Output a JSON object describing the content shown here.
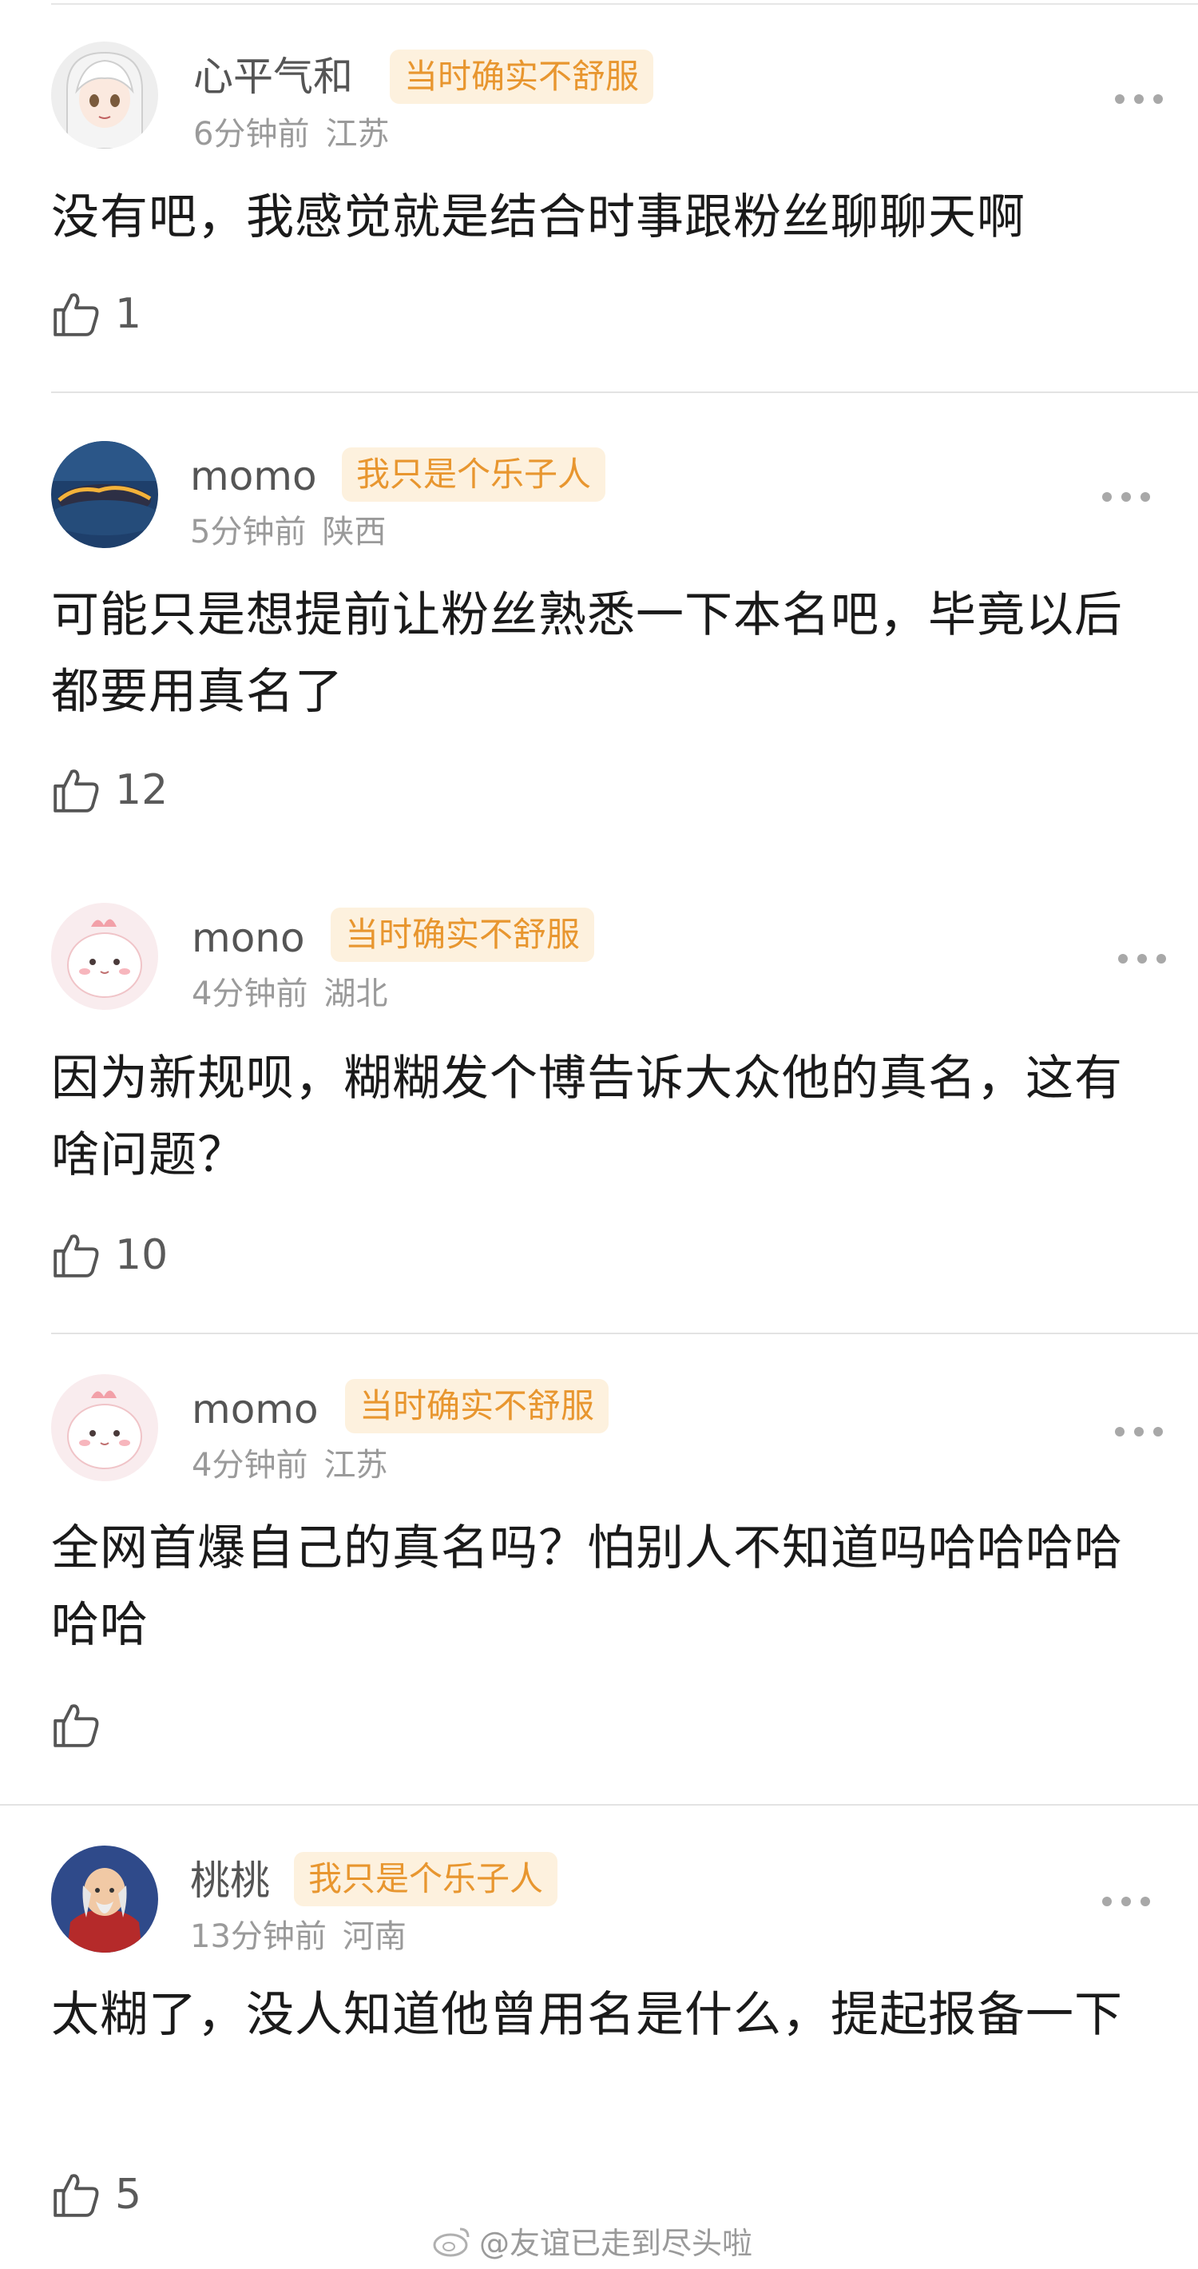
{
  "comments": [
    {
      "username": "心平气和",
      "badge": "当时确实不舒服",
      "time": "6分钟前",
      "location": "江苏",
      "text": "没有吧，我感觉就是结合时事跟粉丝聊聊天啊",
      "likes": "1",
      "avatar_icon": "anime-girl-avatar"
    },
    {
      "username": "momo",
      "badge": "我只是个乐子人",
      "time": "5分钟前",
      "location": "陕西",
      "text": "可能只是想提前让粉丝熟悉一下本名吧，毕竟以后都要用真名了",
      "likes": "12",
      "avatar_icon": "sky-cloud-avatar"
    },
    {
      "username": "mono",
      "badge": "当时确实不舒服",
      "time": "4分钟前",
      "location": "湖北",
      "text": "因为新规呗，糊糊发个博告诉大众他的真名，这有啥问题？",
      "likes": "10",
      "avatar_icon": "pink-cartoon-avatar"
    },
    {
      "username": "momo",
      "badge": "当时确实不舒服",
      "time": "4分钟前",
      "location": "江苏",
      "text": "全网首爆自己的真名吗？怕别人不知道吗哈哈哈哈哈哈",
      "likes": "",
      "avatar_icon": "pink-cartoon-avatar"
    },
    {
      "username": "桃桃",
      "badge": "我只是个乐子人",
      "time": "13分钟前",
      "location": "河南",
      "text": "太糊了，没人知道他曾用名是什么，提起报备一下",
      "likes": "5",
      "avatar_icon": "anime-elder-avatar"
    }
  ],
  "watermark": "@友谊已走到尽头啦",
  "colors": {
    "badge_bg": "#fdf1de",
    "badge_text": "#e8962f",
    "meta_text": "#9a9a9a",
    "username_text": "#555555"
  }
}
